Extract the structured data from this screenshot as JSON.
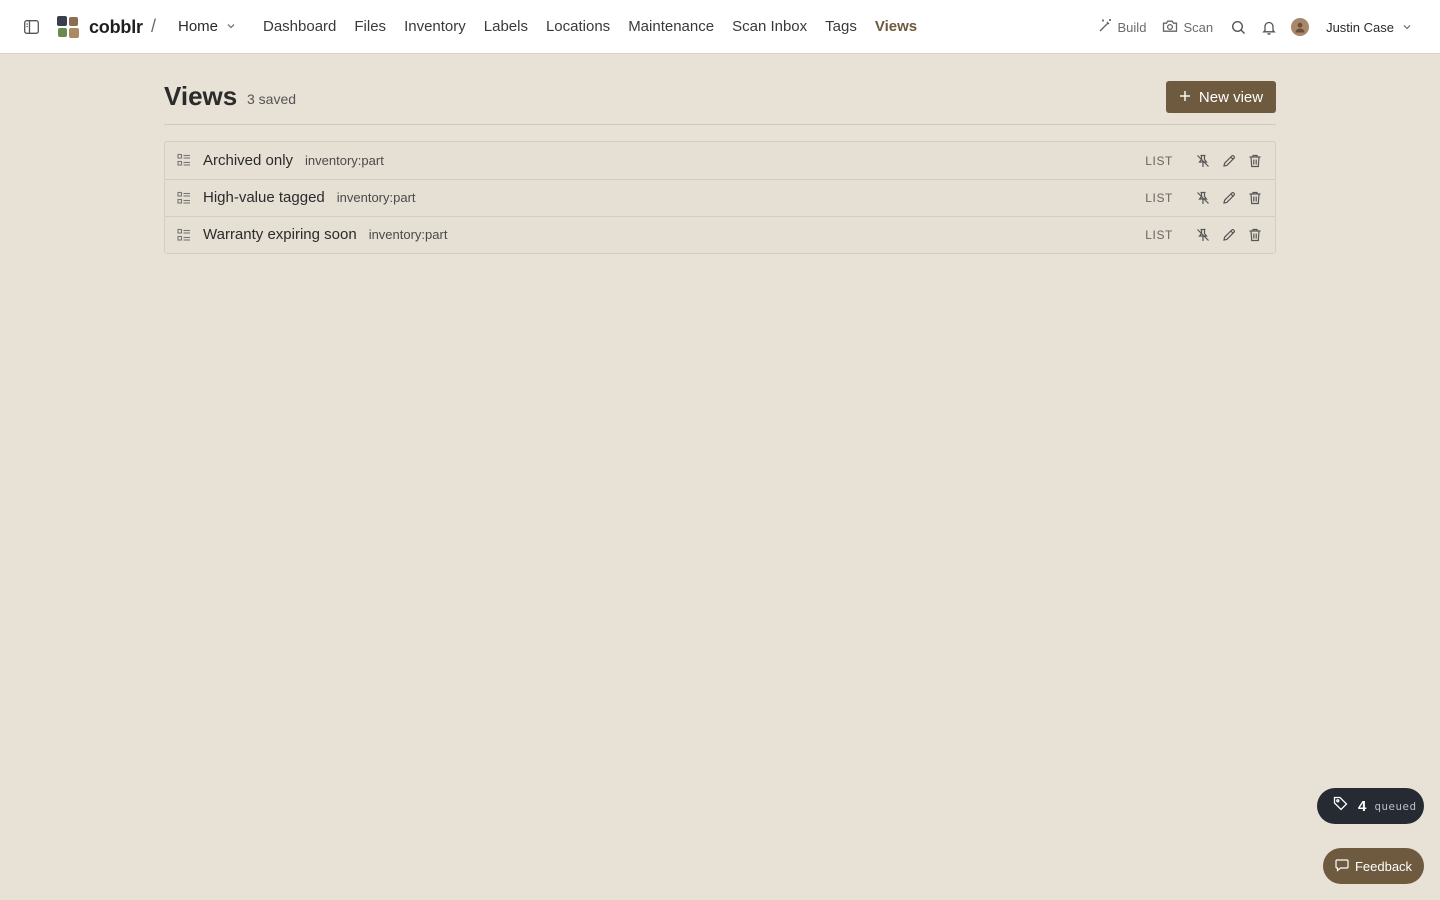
{
  "app": {
    "brand": "cobblr",
    "breadcrumb_separator": "/",
    "home_menu_label": "Home",
    "accent_color": "#6e5a3e"
  },
  "nav": {
    "items": [
      {
        "label": "Dashboard"
      },
      {
        "label": "Files"
      },
      {
        "label": "Inventory"
      },
      {
        "label": "Labels"
      },
      {
        "label": "Locations"
      },
      {
        "label": "Maintenance"
      },
      {
        "label": "Scan Inbox"
      },
      {
        "label": "Tags"
      },
      {
        "label": "Views",
        "active": true
      }
    ]
  },
  "toolbar": {
    "build_label": "Build",
    "scan_label": "Scan",
    "user_name": "Justin Case",
    "icons": [
      "sidebar-toggle-icon",
      "magic-wand-icon",
      "camera-icon",
      "search-icon",
      "bell-icon",
      "avatar",
      "chevron-down-icon"
    ]
  },
  "page": {
    "title": "Views",
    "saved_count": "3 saved",
    "new_view_label": "New view"
  },
  "views": [
    {
      "name": "Archived only",
      "scope": "inventory:part",
      "type": "LIST"
    },
    {
      "name": "High-value tagged",
      "scope": "inventory:part",
      "type": "LIST"
    },
    {
      "name": "Warranty expiring soon",
      "scope": "inventory:part",
      "type": "LIST"
    }
  ],
  "queue": {
    "count": "4",
    "label": "queued"
  },
  "feedback": {
    "label": "Feedback"
  }
}
